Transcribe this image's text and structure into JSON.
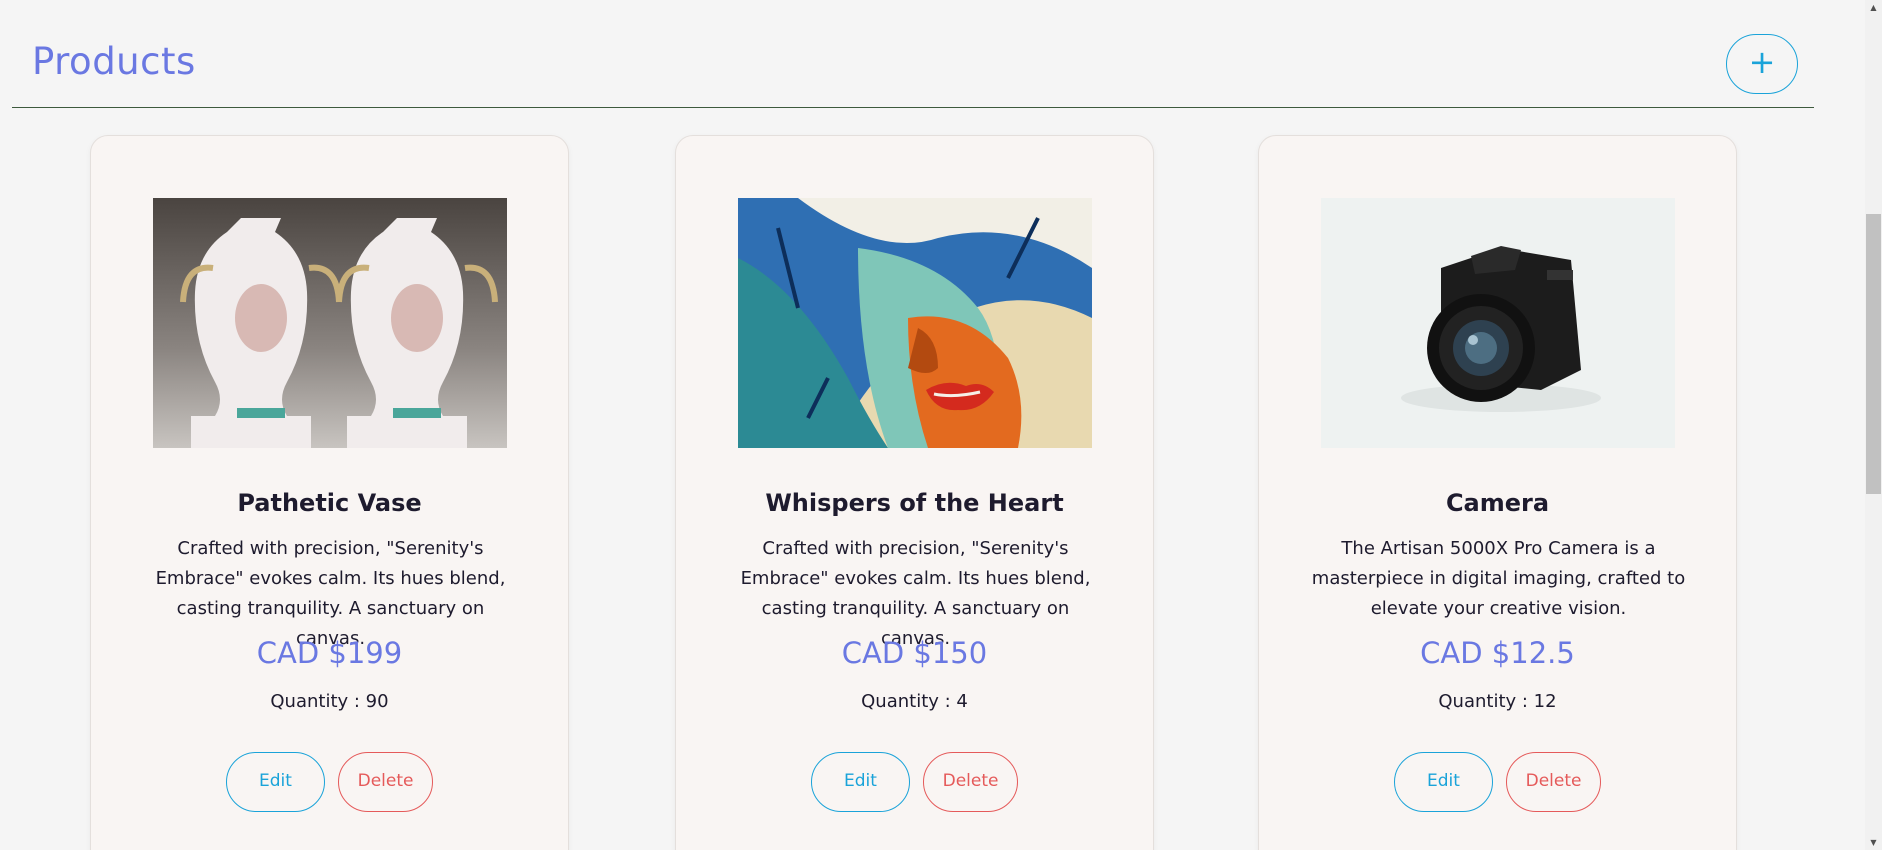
{
  "header": {
    "title": "Products",
    "add_label": "+"
  },
  "products": [
    {
      "name": "Pathetic Vase",
      "description": "Crafted with precision, \"Serenity's Embrace\" evokes calm. Its hues blend, casting tranquility. A sanctuary on canvas.",
      "price": "CAD $199",
      "quantity": "Quantity : 90",
      "edit_label": "Edit",
      "delete_label": "Delete"
    },
    {
      "name": "Whispers of the Heart",
      "description": "Crafted with precision, \"Serenity's Embrace\" evokes calm. Its hues blend, casting tranquility. A sanctuary on canvas.",
      "price": "CAD $150",
      "quantity": "Quantity : 4",
      "edit_label": "Edit",
      "delete_label": "Delete"
    },
    {
      "name": "Camera",
      "description": "The Artisan 5000X Pro Camera is a masterpiece in digital imaging, crafted to elevate your creative vision.",
      "price": "CAD $12.5",
      "quantity": "Quantity : 12",
      "edit_label": "Edit",
      "delete_label": "Delete"
    }
  ],
  "colors": {
    "accent": "#6a78e2",
    "edit": "#1aa3d9",
    "delete": "#e55a5a",
    "divider": "#3d5a3d"
  }
}
